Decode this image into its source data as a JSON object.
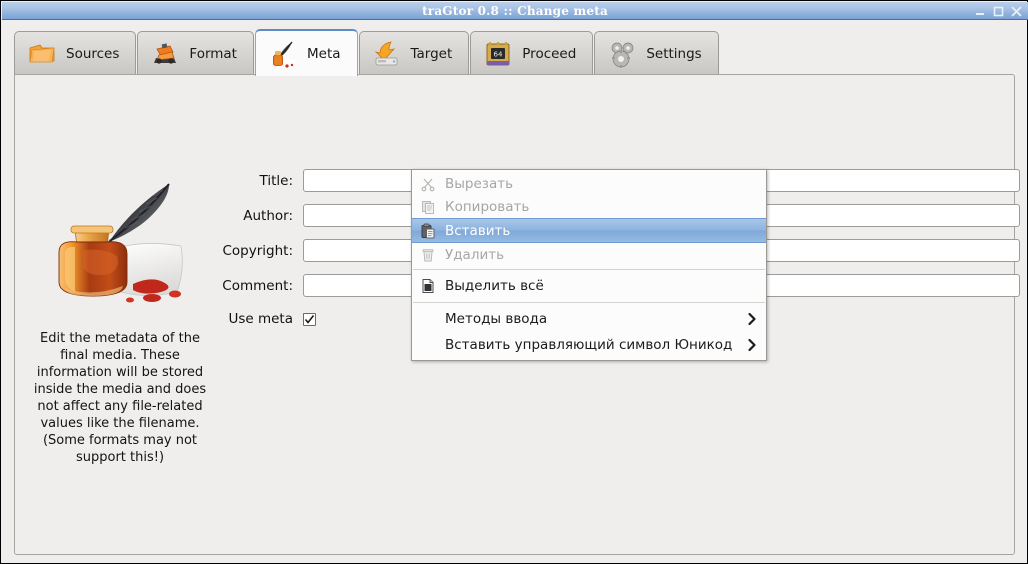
{
  "window": {
    "title": "traGtor 0.8 :: Change meta",
    "controls": [
      {
        "name": "minimize-button",
        "label": "_"
      },
      {
        "name": "maximize-button",
        "label": "☐"
      },
      {
        "name": "close-button",
        "label": "✕"
      }
    ]
  },
  "tabs": [
    {
      "label": "Sources",
      "icon": "folder-icon",
      "active": false
    },
    {
      "label": "Format",
      "icon": "machine-icon",
      "active": false
    },
    {
      "label": "Meta",
      "icon": "quill-inkwell-icon",
      "active": true
    },
    {
      "label": "Target",
      "icon": "drive-arrow-icon",
      "active": false
    },
    {
      "label": "Proceed",
      "icon": "cpu-chip-icon",
      "active": false
    },
    {
      "label": "Settings",
      "icon": "gears-icon",
      "active": false
    }
  ],
  "help": {
    "illustration": "quill-inkwell-illustration",
    "text": "Edit the metadata of the final media. These information will be stored inside the media and does not affect any file-related values like the filename. (Some formats may not support this!)"
  },
  "form": {
    "fields": [
      {
        "label": "Title:",
        "value": "",
        "placeholder": "",
        "name": "title-input"
      },
      {
        "label": "Author:",
        "value": "",
        "placeholder": "",
        "name": "author-input"
      },
      {
        "label": "Copyright:",
        "value": "",
        "placeholder": "",
        "name": "copyright-input"
      },
      {
        "label": "Comment:",
        "value": "",
        "placeholder": "",
        "name": "comment-input"
      }
    ],
    "use_meta": {
      "label": "Use meta",
      "checked": true
    }
  },
  "context_menu": {
    "items": [
      {
        "label": "Вырезать",
        "icon": "scissors-icon",
        "state": "disabled",
        "submenu": false
      },
      {
        "label": "Копировать",
        "icon": "copy-icon",
        "state": "disabled",
        "submenu": false
      },
      {
        "label": "Вставить",
        "icon": "clipboard-paste-icon",
        "state": "selected",
        "submenu": false
      },
      {
        "label": "Удалить",
        "icon": "trash-icon",
        "state": "disabled",
        "submenu": false
      },
      {
        "label": "Выделить всё",
        "icon": "document-icon",
        "state": "enabled",
        "submenu": false
      },
      {
        "label": "Методы ввода",
        "icon": "",
        "state": "enabled",
        "submenu": true
      },
      {
        "label": "Вставить управляющий символ Юникод",
        "icon": "",
        "state": "enabled",
        "submenu": true
      }
    ]
  },
  "colors": {
    "titlebar_top": "#b9cfea",
    "titlebar_bottom": "#7ba2d6",
    "window_bg": "#efeeec",
    "menu_highlight": "#8cb2de",
    "accent_orange": "#e8821e",
    "active_tab_border": "#5f8bc4"
  }
}
